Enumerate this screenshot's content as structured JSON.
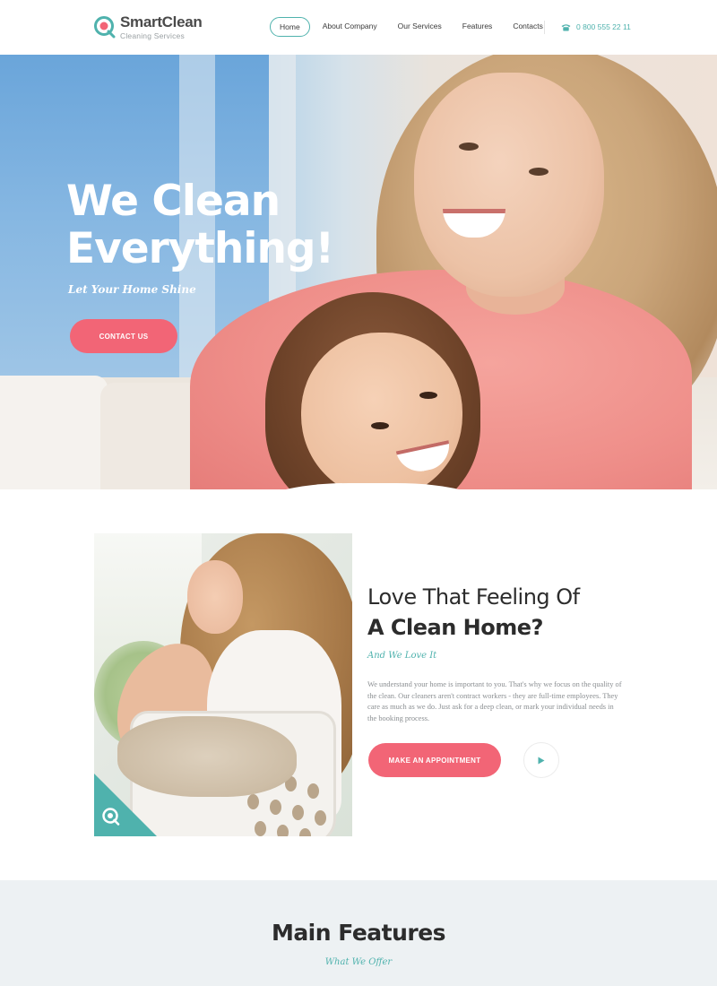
{
  "brand": {
    "name": "SmartClean",
    "tagline": "Cleaning Services"
  },
  "nav": {
    "items": [
      {
        "label": "Home",
        "active": true
      },
      {
        "label": "About Company",
        "active": false
      },
      {
        "label": "Our Services",
        "active": false
      },
      {
        "label": "Features",
        "active": false
      },
      {
        "label": "Contacts",
        "active": false
      }
    ],
    "phone": "0 800 555 22 11",
    "phone_icon": "phone-icon"
  },
  "hero": {
    "title": "We Clean Everything!",
    "subtitle": "Let Your Home Shine",
    "cta_label": "CONTACT US"
  },
  "about": {
    "title_line1": "Love That Feeling Of",
    "title_line2": "A Clean Home?",
    "subtitle": "And We Love It",
    "body": "We understand your home is important to you. That's why we focus on the quality of the clean. Our cleaners aren't contract workers - they are full-time employees. They care as much as we do. Just ask for a deep clean, or mark your individual needs in the booking process.",
    "cta_label": "MAKE AN APPOINTMENT",
    "play_icon": "play-icon"
  },
  "features": {
    "title": "Main Features",
    "subtitle": "What We Offer"
  },
  "colors": {
    "accent_teal": "#4fb2ad",
    "accent_pink": "#f26576",
    "text_dark": "#2c2c2c",
    "text_muted": "#8b8f92",
    "section_bg": "#edf1f3"
  }
}
